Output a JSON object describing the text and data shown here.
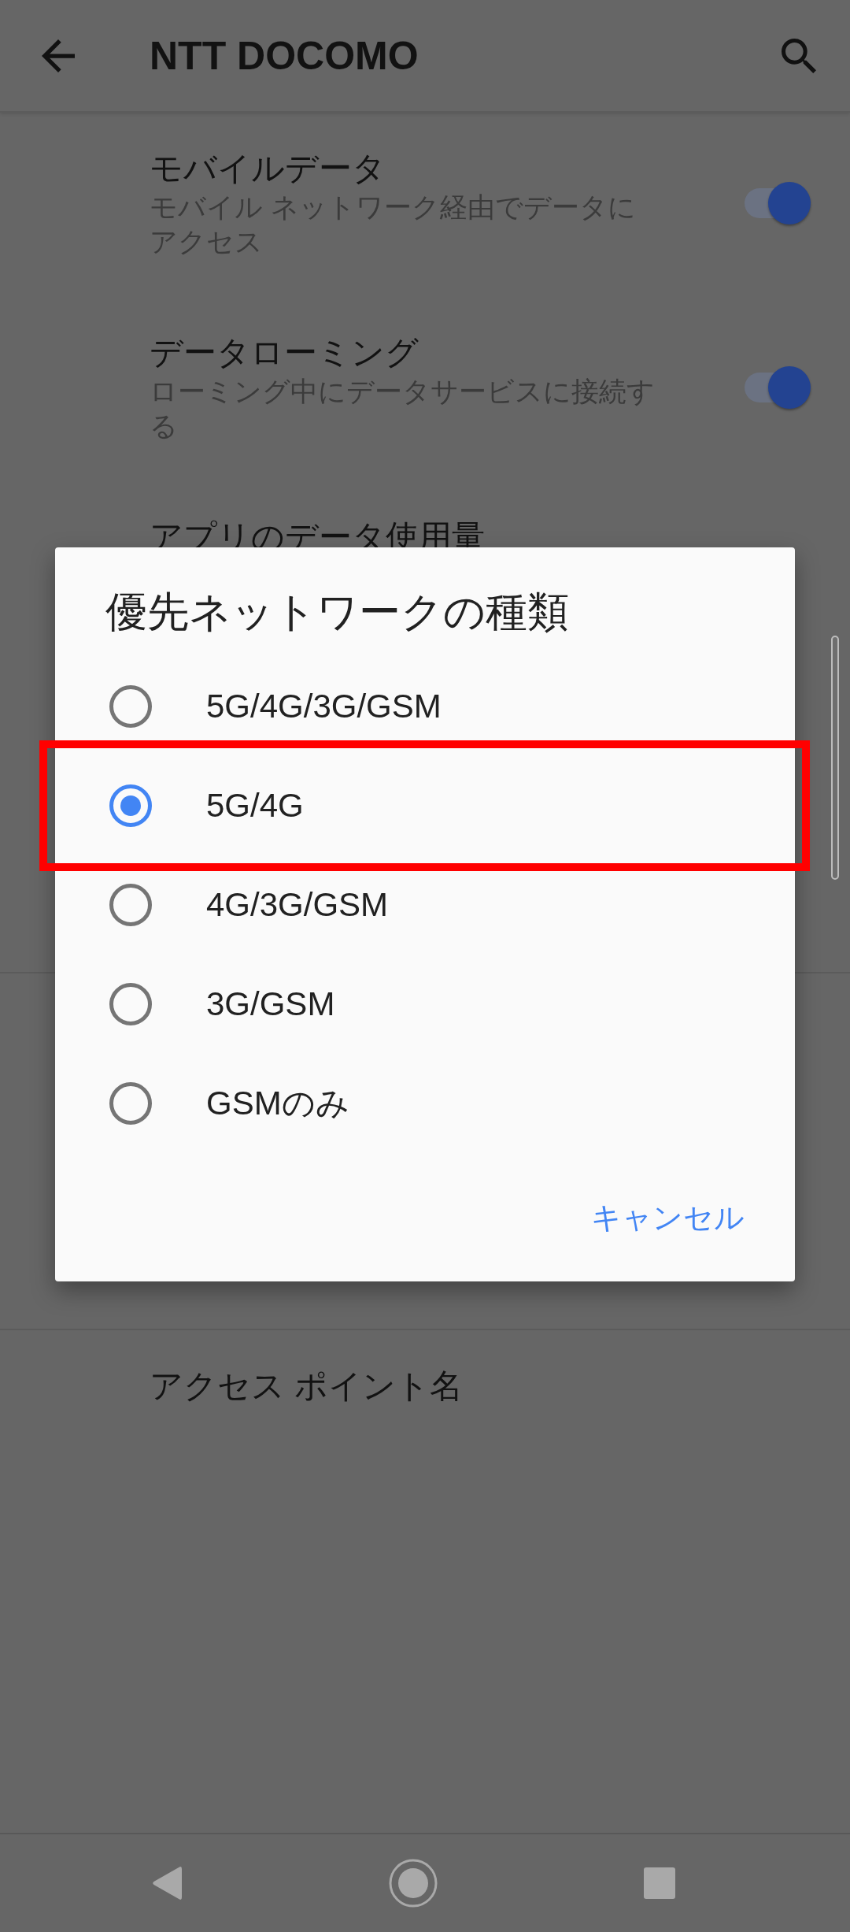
{
  "app_bar": {
    "title": "NTT DOCOMO"
  },
  "sections": [
    {
      "rows": [
        {
          "kind": "toggle",
          "title": "モバイルデータ",
          "subtitle": "モバイル ネットワーク経由でデータにアクセス",
          "on": true
        },
        {
          "kind": "toggle",
          "title": "データローミング",
          "subtitle": "ローミング中にデータサービスに接続する",
          "on": true
        },
        {
          "kind": "plain",
          "title": "アプリのデータ使用量"
        }
      ]
    },
    {
      "rows": [
        {
          "kind": "plain",
          "title": "アクセス ポイント名"
        }
      ]
    }
  ],
  "dialog": {
    "title": "優先ネットワークの種類",
    "options": [
      {
        "label": "5G/4G/3G/GSM",
        "selected": false,
        "highlighted": false
      },
      {
        "label": "5G/4G",
        "selected": true,
        "highlighted": true
      },
      {
        "label": "4G/3G/GSM",
        "selected": false,
        "highlighted": false
      },
      {
        "label": "3G/GSM",
        "selected": false,
        "highlighted": false
      },
      {
        "label": "GSMのみ",
        "selected": false,
        "highlighted": false
      }
    ],
    "buttons": [
      {
        "label": "キャンセル"
      }
    ]
  }
}
